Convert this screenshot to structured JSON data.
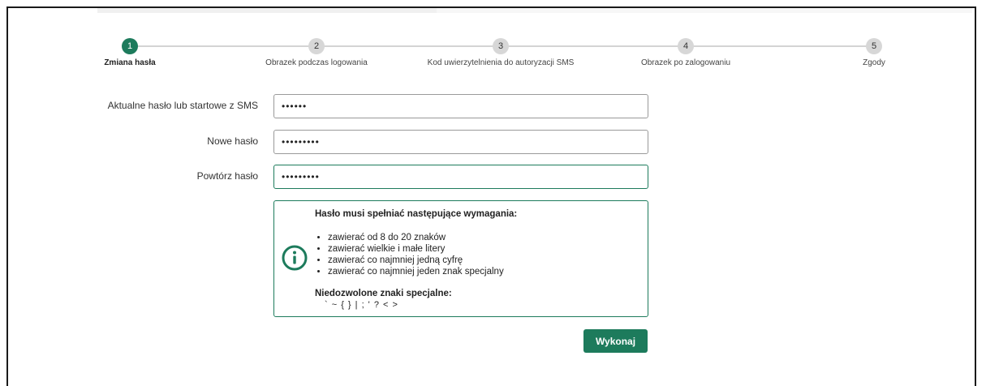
{
  "stepper": {
    "steps": [
      {
        "number": "1",
        "label": "Zmiana hasła",
        "active": true
      },
      {
        "number": "2",
        "label": "Obrazek podczas logowania",
        "active": false
      },
      {
        "number": "3",
        "label": "Kod uwierzytelnienia do autoryzacji SMS",
        "active": false
      },
      {
        "number": "4",
        "label": "Obrazek po zalogowaniu",
        "active": false
      },
      {
        "number": "5",
        "label": "Zgody",
        "active": false
      }
    ]
  },
  "form": {
    "current_password": {
      "label": "Aktualne hasło lub startowe z SMS",
      "value": "••••••"
    },
    "new_password": {
      "label": "Nowe hasło",
      "value": "•••••••••"
    },
    "repeat_password": {
      "label": "Powtórz hasło",
      "value": "•••••••••"
    }
  },
  "requirements": {
    "title": "Hasło musi spełniać następujące wymagania:",
    "items": [
      "zawierać od 8 do 20 znaków",
      "zawierać wielkie i małe litery",
      "zawierać co najmniej jedną cyfrę",
      "zawierać co najmniej jeden znak specjalny"
    ],
    "forbidden_title": "Niedozwolone znaki specjalne:",
    "forbidden_chars": "` ~ { } | ; ' ? < >",
    "icon": "info-circle-icon"
  },
  "actions": {
    "submit_label": "Wykonaj"
  },
  "colors": {
    "accent": "#1d7b5c",
    "inactive_step": "#d7d7d7",
    "border": "#9a9a9a"
  }
}
